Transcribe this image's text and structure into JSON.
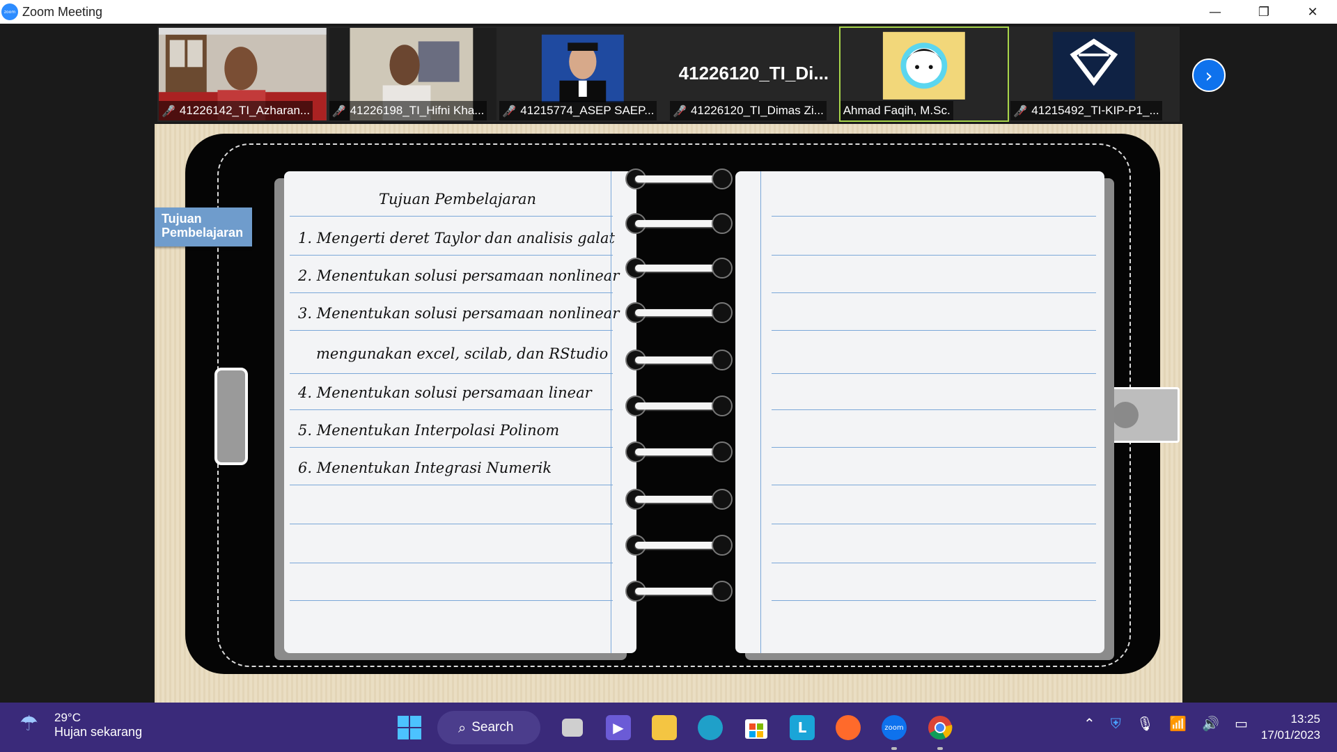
{
  "window": {
    "title": "Zoom Meeting",
    "app_icon_text": "zoom",
    "minimize": "—",
    "restore": "❐",
    "close": "✕"
  },
  "participants": [
    {
      "name": "41226142_TI_Azharan...",
      "muted": true,
      "video": "webcam"
    },
    {
      "name": "41226198_TI_Hifni Kha...",
      "muted": true,
      "video": "webcam"
    },
    {
      "name": "41215774_ASEP SAEP...",
      "muted": true,
      "video": "photo"
    },
    {
      "name": "41226120_TI_Dimas Zi...",
      "muted": true,
      "video": "off",
      "big_name": "41226120_TI_Di..."
    },
    {
      "name": "Ahmad Faqih, M.Sc.",
      "muted": false,
      "video": "avatar",
      "active": true
    },
    {
      "name": "41215492_TI-KIP-P1_...",
      "muted": true,
      "video": "logo"
    }
  ],
  "next_page_icon": "›",
  "slide": {
    "side_tab": "Tujuan Pembelajaran",
    "heading": "Tujuan Pembelajaran",
    "items": [
      "1. Mengerti deret Taylor dan analisis galat",
      "2. Menentukan solusi persamaan nonlinear",
      "3. Menentukan solusi persamaan nonlinear",
      "mengunakan excel, scilab, dan RStudio",
      "4. Menentukan solusi persamaan linear",
      "5. Menentukan Interpolasi Polinom",
      "6. Menentukan Integrasi Numerik"
    ]
  },
  "taskbar": {
    "weather_temp": "29°C",
    "weather_cond": "Hujan sekarang",
    "search_label": "Search",
    "time": "13:25",
    "date": "17/01/2023",
    "apps": [
      "start-icon",
      "task-view-icon",
      "chat-icon",
      "file-explorer-icon",
      "edge-icon",
      "store-icon",
      "l-app-icon",
      "firefox-icon",
      "zoom-icon",
      "chrome-icon"
    ],
    "zoom_icon_text": "zoom",
    "l_icon_text": "L"
  },
  "colors": {
    "accent": "#0e72ed",
    "active_border": "#a9d64a",
    "taskbar": "#3a2a7a",
    "mute": "#e0393e"
  }
}
